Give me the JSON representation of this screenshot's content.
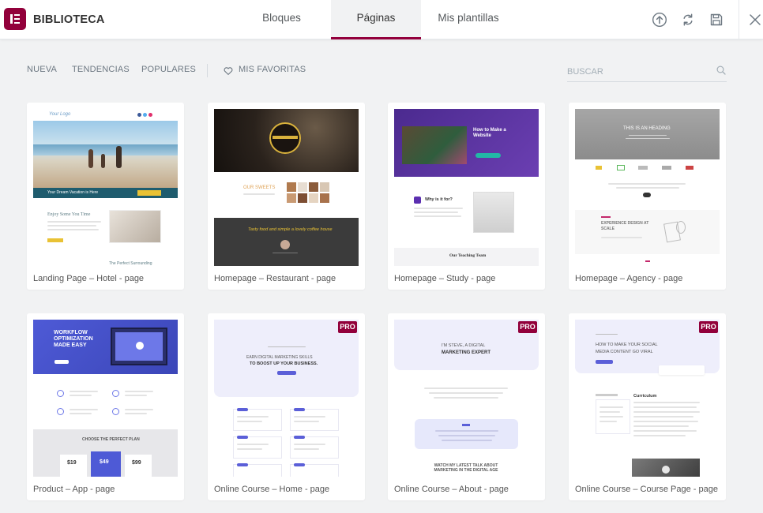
{
  "header": {
    "brand": "BIBLIOTECA",
    "tabs": [
      "Bloques",
      "Páginas",
      "Mis plantillas"
    ],
    "active_tab": "Páginas",
    "icons": [
      "upload-icon",
      "sync-icon",
      "save-icon",
      "close-icon"
    ]
  },
  "filters": {
    "items": [
      "NUEVA",
      "TENDENCIAS",
      "POPULARES"
    ],
    "favorites": "MIS FAVORITAS"
  },
  "search": {
    "placeholder": "BUSCAR"
  },
  "colors": {
    "brand": "#92003b",
    "background": "#f1f2f3",
    "pro_badge": "#92003b"
  },
  "cards": [
    {
      "title": "Landing Page – Hotel - page",
      "pro": false,
      "thumb": {
        "logo": "Your Logo",
        "banner": "Your Dream Vacation is Here",
        "heading": "Enjoy Some You Time",
        "footer": "The Perfect Surrounding"
      }
    },
    {
      "title": "Homepage – Restaurant - page",
      "pro": false,
      "thumb": {
        "heading": "OUR SWEETS",
        "quote": "Tasty food and simple a lovely coffee house"
      }
    },
    {
      "title": "Homepage – Study - page",
      "pro": false,
      "thumb": {
        "hero": "How to Make a Website",
        "section": "Why is it for?",
        "footer": "Our Teaching Team"
      }
    },
    {
      "title": "Homepage – Agency - page",
      "pro": false,
      "thumb": {
        "hero": "THIS IS AN HEADING",
        "section": "EXPERIENCE DESIGN AT SCALE"
      }
    },
    {
      "title": "Product – App - page",
      "pro": false,
      "thumb": {
        "hero": "WORKFLOW OPTIMIZATION MADE EASY",
        "pricing": "CHOOSE THE PERFECT PLAN",
        "prices": [
          "$19",
          "$49",
          "$99"
        ]
      }
    },
    {
      "title": "Online Course – Home - page",
      "pro": true,
      "badge": "PRO",
      "thumb": {
        "hero_line1": "EARN DIGITAL MARKETING SKILLS",
        "hero_line2": "TO BOOST UP YOUR BUSINESS."
      }
    },
    {
      "title": "Online Course – About - page",
      "pro": true,
      "badge": "PRO",
      "thumb": {
        "hero_line1": "I'M STEVE, A DIGITAL",
        "hero_line2": "MARKETING EXPERT",
        "bottom": "WATCH MY LATEST TALK ABOUT MARKETING IN THE DIGITAL AGE"
      }
    },
    {
      "title": "Online Course – Course Page - page",
      "pro": true,
      "badge": "PRO",
      "thumb": {
        "hero_line1": "HOW TO MAKE YOUR SOCIAL",
        "hero_line2": "MEDIA CONTENT GO VIRAL",
        "section": "Curriculum"
      }
    }
  ]
}
